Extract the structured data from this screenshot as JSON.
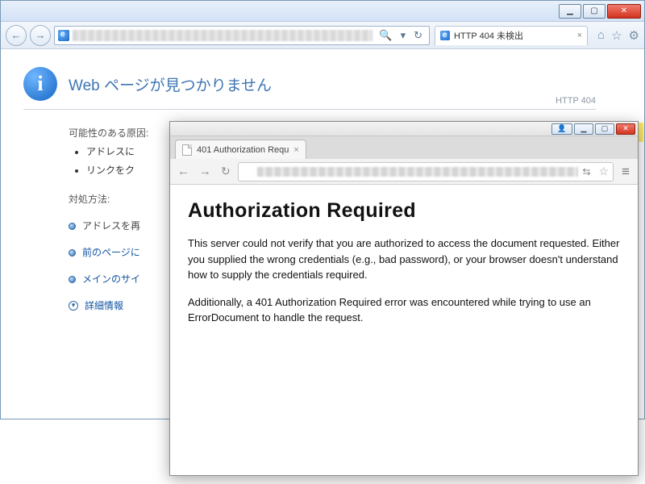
{
  "ie": {
    "tab_title": "HTTP 404 未検出",
    "page_title": "Web ページが見つかりません",
    "http_code": "HTTP 404",
    "causes_heading": "可能性のある原因:",
    "causes": [
      "アドレスに",
      "リンクをク"
    ],
    "actions_heading": "対処方法:",
    "action_retype": "アドレスを再",
    "action_back": "前のページに",
    "action_main": "メインのサイ",
    "action_details": "詳細情報"
  },
  "chrome": {
    "tab_title": "401 Authorization Requ",
    "page_title": "Authorization Required",
    "para1": "This server could not verify that you are authorized to access the document requested. Either you supplied the wrong credentials (e.g., bad password), or your browser doesn't understand how to supply the credentials required.",
    "para2": "Additionally, a 401 Authorization Required error was encountered while trying to use an ErrorDocument to handle the request."
  },
  "win": {
    "minimize": "▁",
    "maximize": "▢",
    "close": "✕",
    "user": "👤"
  }
}
